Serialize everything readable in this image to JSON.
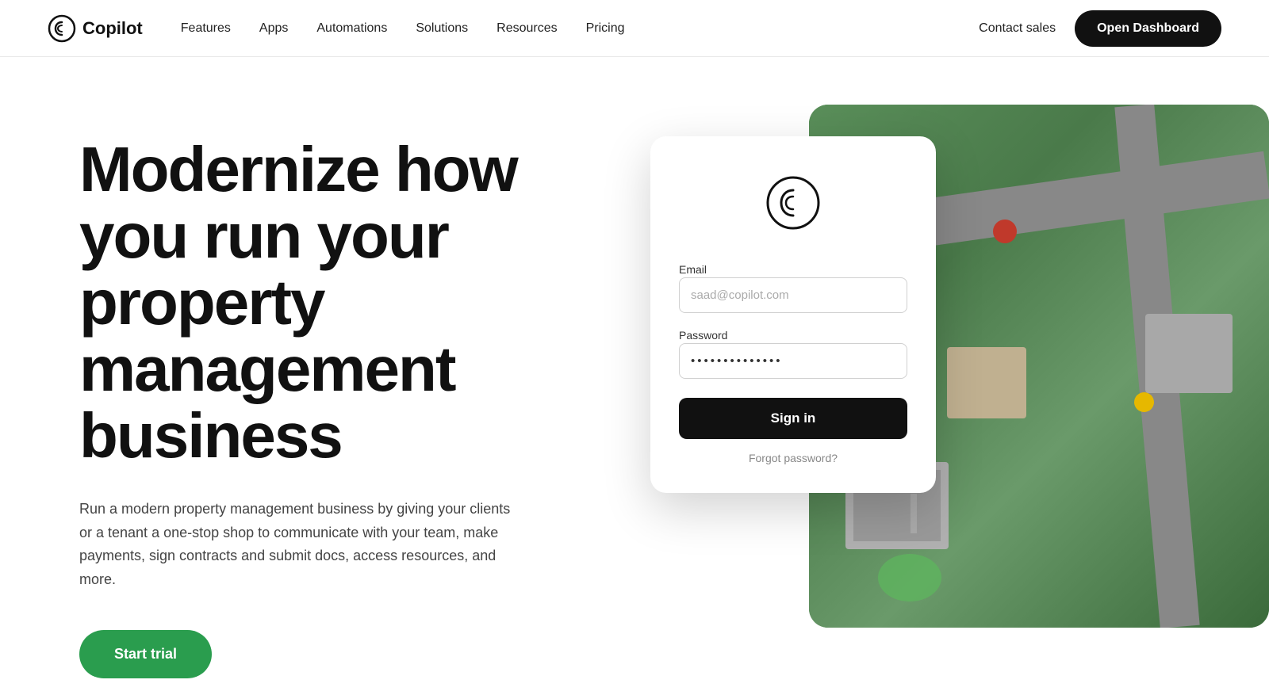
{
  "nav": {
    "logo_text": "Copilot",
    "links": [
      {
        "label": "Features",
        "id": "features"
      },
      {
        "label": "Apps",
        "id": "apps"
      },
      {
        "label": "Automations",
        "id": "automations"
      },
      {
        "label": "Solutions",
        "id": "solutions"
      },
      {
        "label": "Resources",
        "id": "resources"
      },
      {
        "label": "Pricing",
        "id": "pricing"
      }
    ],
    "contact_sales": "Contact sales",
    "open_dashboard": "Open Dashboard"
  },
  "hero": {
    "headline": "Modernize how you run your property management business",
    "subtext": "Run a modern property management business by giving your clients or a tenant a one-stop shop to communicate with your team, make payments, sign contracts and submit docs, access resources, and more.",
    "cta_label": "Start trial"
  },
  "login_card": {
    "email_label": "Email",
    "email_placeholder": "saad@copilot.com",
    "password_label": "Password",
    "password_value": "••••••••••••••",
    "sign_in_label": "Sign in",
    "forgot_password": "Forgot password?"
  }
}
